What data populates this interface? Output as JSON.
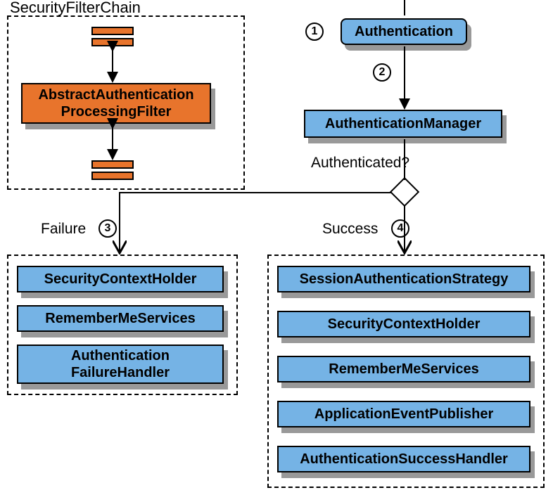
{
  "filterChain": {
    "title": "SecurityFilterChain",
    "mainFilter": "AbstractAuthentication\nProcessingFilter"
  },
  "steps": {
    "s1": "1",
    "s2": "2",
    "s3": "3",
    "s4": "4"
  },
  "authentication": "Authentication",
  "authManager": "AuthenticationManager",
  "authQuestion": "Authenticated?",
  "failure": {
    "title": "Failure",
    "items": [
      "SecurityContextHolder",
      "RememberMeServices",
      "Authentication\nFailureHandler"
    ]
  },
  "success": {
    "title": "Success",
    "items": [
      "SessionAuthenticationStrategy",
      "SecurityContextHolder",
      "RememberMeServices",
      "ApplicationEventPublisher",
      "AuthenticationSuccessHandler"
    ]
  }
}
